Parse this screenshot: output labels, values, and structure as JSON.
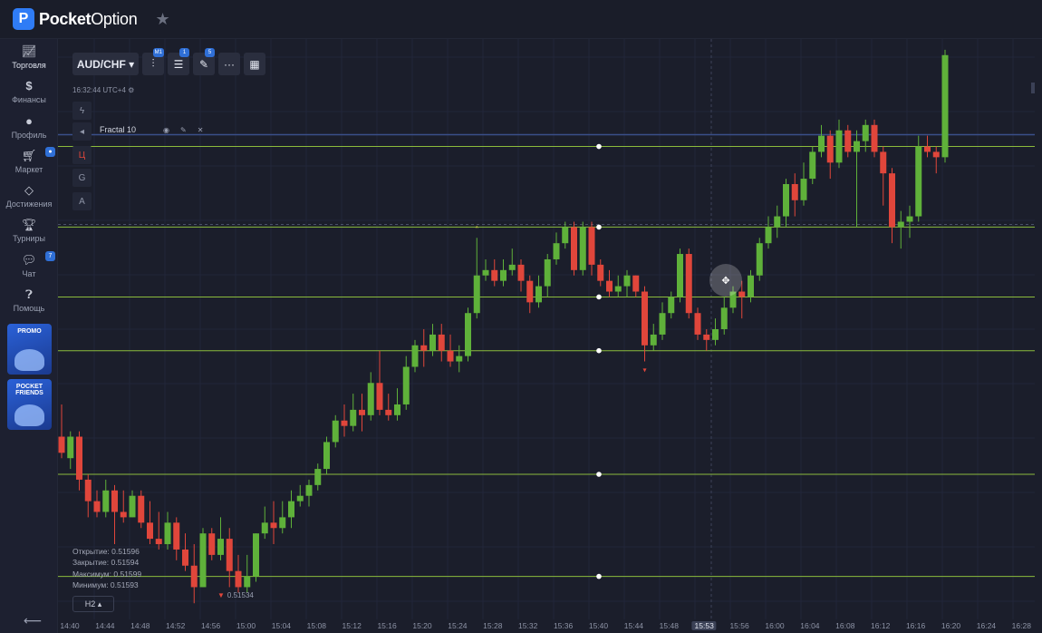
{
  "app": {
    "logo_letter": "P",
    "name_bold": "Pocket",
    "name_rest": "Option"
  },
  "sidebar": {
    "items": [
      {
        "label": "Торговля",
        "icon": "chart-line-icon"
      },
      {
        "label": "Финансы",
        "icon": "dollar-icon"
      },
      {
        "label": "Профиль",
        "icon": "user-icon"
      },
      {
        "label": "Маркет",
        "icon": "cart-icon"
      },
      {
        "label": "Достижения",
        "icon": "diamond-icon"
      },
      {
        "label": "Турниры",
        "icon": "trophy-icon"
      },
      {
        "label": "Чат",
        "icon": "chat-icon",
        "badge": "7"
      },
      {
        "label": "Помощь",
        "icon": "help-icon"
      }
    ],
    "promo": "PROMO",
    "pocket_friends": "POCKET FRIENDS"
  },
  "toolbar": {
    "pair": "AUD/CHF ▾",
    "chart_type_badge": "M1",
    "indicators_badge": "1",
    "drawings_badge": "5",
    "more": "···"
  },
  "clock": "16:32:44 UTC+4 ⚙",
  "tool_column": [
    "ϟ",
    "Ц",
    "G",
    "A"
  ],
  "indicator": {
    "name": "Fractal 10"
  },
  "ohlc": {
    "open": "Открытие: 0.51596",
    "close": "Закрытие: 0.51594",
    "high": "Максимум: 0.51599",
    "low": "Минимум: 0.51593"
  },
  "timeframe": "H2 ▴",
  "low_marker": "0.51534",
  "time_axis": {
    "ticks": [
      "14:40",
      "14:44",
      "14:48",
      "14:52",
      "14:56",
      "15:00",
      "15:04",
      "15:08",
      "15:12",
      "15:16",
      "15:20",
      "15:24",
      "15:28",
      "15:32",
      "15:36",
      "15:40",
      "15:44",
      "15:48",
      "15:53",
      "15:56",
      "16:00",
      "16:04",
      "16:08",
      "16:12",
      "16:16",
      "16:20",
      "16:24",
      "16:28"
    ],
    "highlighted": "15:53"
  },
  "colors": {
    "up": "#5fb13a",
    "down": "#e0463b",
    "hline": "#8bbb3c",
    "bg": "#1b1e2b",
    "accent": "#2f7cf6"
  },
  "chart_data": {
    "type": "candlestick",
    "low_label": "0.51534",
    "candles": [
      [
        0.517,
        0.5167,
        0.5176,
        0.5166
      ],
      [
        0.5166,
        0.517,
        0.5171,
        0.5164
      ],
      [
        0.517,
        0.5162,
        0.5171,
        0.516
      ],
      [
        0.5162,
        0.5158,
        0.5163,
        0.5155
      ],
      [
        0.5158,
        0.5156,
        0.516,
        0.5155
      ],
      [
        0.5156,
        0.516,
        0.5162,
        0.5155
      ],
      [
        0.516,
        0.5156,
        0.5161,
        0.515
      ],
      [
        0.5156,
        0.5155,
        0.516,
        0.5154
      ],
      [
        0.5155,
        0.5159,
        0.516,
        0.5155
      ],
      [
        0.5159,
        0.5154,
        0.516,
        0.5153
      ],
      [
        0.5154,
        0.5151,
        0.5158,
        0.515
      ],
      [
        0.5151,
        0.515,
        0.5156,
        0.5149
      ],
      [
        0.515,
        0.5154,
        0.5156,
        0.5149
      ],
      [
        0.5154,
        0.5149,
        0.5155,
        0.5147
      ],
      [
        0.5149,
        0.5146,
        0.5152,
        0.5145
      ],
      [
        0.5146,
        0.5142,
        0.515,
        0.5139
      ],
      [
        0.5142,
        0.5152,
        0.5153,
        0.5142
      ],
      [
        0.5152,
        0.5148,
        0.5153,
        0.5147
      ],
      [
        0.5148,
        0.5151,
        0.5155,
        0.5147
      ],
      [
        0.5151,
        0.5145,
        0.5153,
        0.5142
      ],
      [
        0.5145,
        0.5142,
        0.5148,
        0.5141
      ],
      [
        0.5142,
        0.5144,
        0.5148,
        0.5141
      ],
      [
        0.5144,
        0.5152,
        0.5152,
        0.5143
      ],
      [
        0.5152,
        0.5154,
        0.5157,
        0.5151
      ],
      [
        0.5154,
        0.5153,
        0.5158,
        0.515
      ],
      [
        0.5153,
        0.5155,
        0.5158,
        0.5152
      ],
      [
        0.5155,
        0.5158,
        0.516,
        0.5153
      ],
      [
        0.5158,
        0.5159,
        0.5161,
        0.5157
      ],
      [
        0.5159,
        0.5161,
        0.5162,
        0.5157
      ],
      [
        0.5161,
        0.5164,
        0.5165,
        0.516
      ],
      [
        0.5164,
        0.5169,
        0.517,
        0.5163
      ],
      [
        0.5169,
        0.5173,
        0.5174,
        0.5168
      ],
      [
        0.5173,
        0.5172,
        0.5176,
        0.517
      ],
      [
        0.5172,
        0.5175,
        0.5178,
        0.5171
      ],
      [
        0.5175,
        0.5174,
        0.5178,
        0.5171
      ],
      [
        0.5174,
        0.518,
        0.5182,
        0.5173
      ],
      [
        0.518,
        0.5175,
        0.5186,
        0.5174
      ],
      [
        0.5175,
        0.5174,
        0.5178,
        0.5173
      ],
      [
        0.5174,
        0.5176,
        0.5179,
        0.5173
      ],
      [
        0.5176,
        0.5183,
        0.5185,
        0.5175
      ],
      [
        0.5183,
        0.5187,
        0.5188,
        0.5182
      ],
      [
        0.5187,
        0.5186,
        0.519,
        0.5183
      ],
      [
        0.5186,
        0.5189,
        0.5191,
        0.5185
      ],
      [
        0.5189,
        0.5186,
        0.5191,
        0.5184
      ],
      [
        0.5186,
        0.5184,
        0.5189,
        0.5183
      ],
      [
        0.5184,
        0.5185,
        0.5187,
        0.5182
      ],
      [
        0.5185,
        0.5193,
        0.5194,
        0.5184
      ],
      [
        0.5193,
        0.52,
        0.5207,
        0.5192
      ],
      [
        0.52,
        0.5201,
        0.5203,
        0.5199
      ],
      [
        0.5201,
        0.5199,
        0.5203,
        0.5198
      ],
      [
        0.5199,
        0.5201,
        0.5203,
        0.5198
      ],
      [
        0.5201,
        0.5202,
        0.5205,
        0.52
      ],
      [
        0.5202,
        0.5199,
        0.5203,
        0.5197
      ],
      [
        0.5199,
        0.5195,
        0.52,
        0.5193
      ],
      [
        0.5195,
        0.5198,
        0.52,
        0.5194
      ],
      [
        0.5198,
        0.5203,
        0.5204,
        0.5196
      ],
      [
        0.5203,
        0.5206,
        0.5208,
        0.5202
      ],
      [
        0.5206,
        0.5209,
        0.521,
        0.5205
      ],
      [
        0.5209,
        0.5201,
        0.521,
        0.52
      ],
      [
        0.5201,
        0.5209,
        0.521,
        0.52
      ],
      [
        0.5209,
        0.5202,
        0.521,
        0.52
      ],
      [
        0.5202,
        0.5199,
        0.5203,
        0.5198
      ],
      [
        0.5199,
        0.5197,
        0.5201,
        0.5196
      ],
      [
        0.5197,
        0.5198,
        0.52,
        0.5196
      ],
      [
        0.5198,
        0.52,
        0.5201,
        0.5196
      ],
      [
        0.52,
        0.5197,
        0.52,
        0.5196
      ],
      [
        0.5197,
        0.5187,
        0.5198,
        0.5184
      ],
      [
        0.5187,
        0.5189,
        0.5191,
        0.5186
      ],
      [
        0.5189,
        0.5193,
        0.5195,
        0.5188
      ],
      [
        0.5193,
        0.5196,
        0.5197,
        0.5192
      ],
      [
        0.5196,
        0.5204,
        0.5205,
        0.5195
      ],
      [
        0.5204,
        0.5193,
        0.5205,
        0.5192
      ],
      [
        0.5193,
        0.5189,
        0.5194,
        0.5188
      ],
      [
        0.5189,
        0.5188,
        0.519,
        0.5186
      ],
      [
        0.5188,
        0.519,
        0.5192,
        0.5187
      ],
      [
        0.519,
        0.5194,
        0.5196,
        0.5189
      ],
      [
        0.5194,
        0.5197,
        0.5198,
        0.5193
      ],
      [
        0.5197,
        0.5196,
        0.5199,
        0.5192
      ],
      [
        0.5196,
        0.52,
        0.5201,
        0.5195
      ],
      [
        0.52,
        0.5206,
        0.5207,
        0.5199
      ],
      [
        0.5206,
        0.5209,
        0.5211,
        0.5205
      ],
      [
        0.5209,
        0.5211,
        0.5213,
        0.5207
      ],
      [
        0.5211,
        0.5217,
        0.5218,
        0.5209
      ],
      [
        0.5217,
        0.5214,
        0.5219,
        0.5211
      ],
      [
        0.5214,
        0.5218,
        0.5221,
        0.5213
      ],
      [
        0.5218,
        0.5223,
        0.5224,
        0.5217
      ],
      [
        0.5223,
        0.5226,
        0.5228,
        0.5222
      ],
      [
        0.5226,
        0.5221,
        0.5227,
        0.5218
      ],
      [
        0.5221,
        0.5227,
        0.5229,
        0.522
      ],
      [
        0.5227,
        0.5223,
        0.5228,
        0.5222
      ],
      [
        0.5223,
        0.5225,
        0.5227,
        0.5209
      ],
      [
        0.5225,
        0.5228,
        0.5229,
        0.5223
      ],
      [
        0.5228,
        0.5223,
        0.5229,
        0.5222
      ],
      [
        0.5223,
        0.5219,
        0.5224,
        0.5213
      ],
      [
        0.5219,
        0.5209,
        0.522,
        0.5206
      ],
      [
        0.5209,
        0.521,
        0.5212,
        0.5205
      ],
      [
        0.521,
        0.5211,
        0.5213,
        0.5207
      ],
      [
        0.5211,
        0.5224,
        0.5226,
        0.521
      ],
      [
        0.5224,
        0.5223,
        0.5226,
        0.5222
      ],
      [
        0.5223,
        0.5222,
        0.5224,
        0.5219
      ],
      [
        0.5222,
        0.5241,
        0.5242,
        0.5221
      ]
    ],
    "ylim": [
      0.5136,
      0.5244
    ],
    "levels": [
      0.5224,
      0.5209,
      0.5196,
      0.5186,
      0.5163,
      0.5144
    ],
    "fractals": {
      "up_index": 47,
      "down_index": 66
    }
  }
}
